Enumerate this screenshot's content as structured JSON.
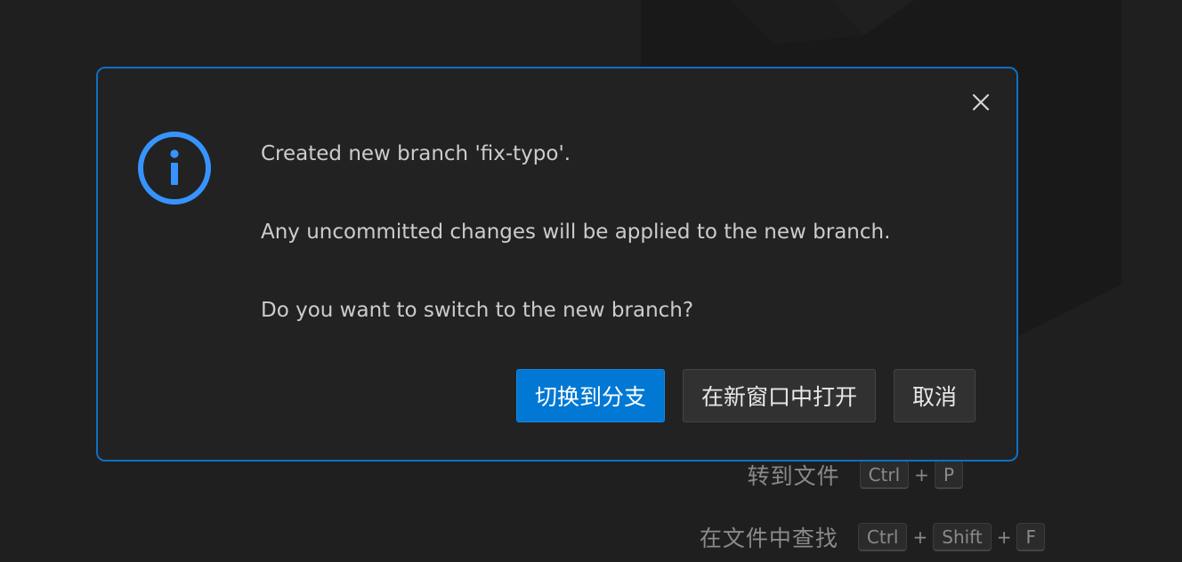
{
  "background_hints": [
    {
      "label": "转到文件",
      "keys": [
        "Ctrl",
        "P"
      ]
    },
    {
      "label": "在文件中查找",
      "keys": [
        "Ctrl",
        "Shift",
        "F"
      ]
    }
  ],
  "dialog": {
    "close_icon": "close-icon",
    "icon": "info-icon",
    "messages": [
      "Created new branch 'fix-typo'.",
      "Any uncommitted changes will be applied to the new branch.",
      "Do you want to switch to the new branch?"
    ],
    "buttons": {
      "switch": "切换到分支",
      "open_new_window": "在新窗口中打开",
      "cancel": "取消"
    }
  },
  "colors": {
    "background": "#1f1f1f",
    "dialog_background": "#222222",
    "dialog_border": "#0e70c0",
    "accent": "#0078d4",
    "info_icon": "#3794ff",
    "text": "#cccccc"
  }
}
